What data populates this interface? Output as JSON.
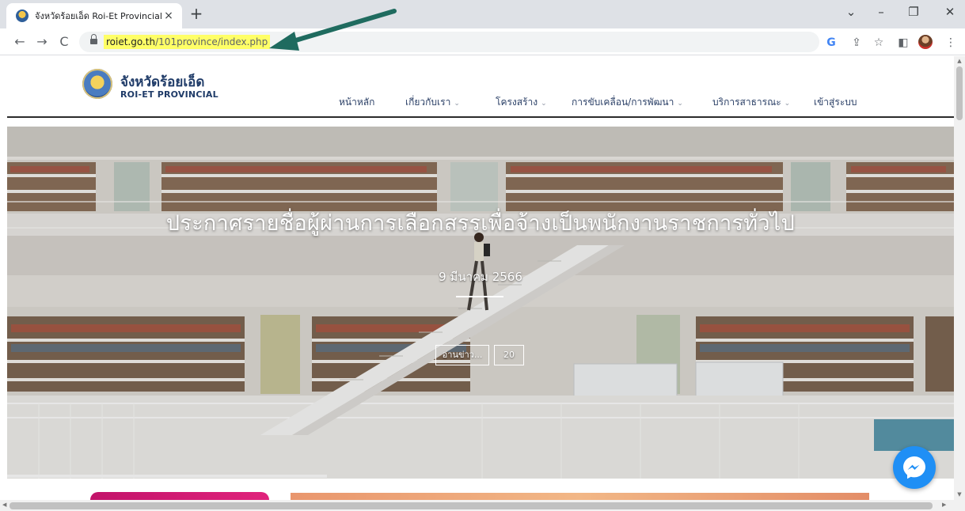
{
  "browser": {
    "tab_title": "จังหวัดร้อยเอ็ด Roi-Et Provincial",
    "tab_close": "×",
    "new_tab": "+",
    "url_domain": "roiet.go.th",
    "url_path": "/101province/index.php",
    "nav": {
      "back": "←",
      "forward": "→",
      "reload": "C"
    },
    "window": {
      "dropdown": "⌄",
      "minimize": "–",
      "restore": "❐",
      "close": "✕"
    },
    "toolbar_icons": {
      "google": "G",
      "share": "⇪",
      "bookmark": "☆",
      "sidepanel": "◧",
      "menu": "⋮"
    }
  },
  "site": {
    "name_th": "จังหวัดร้อยเอ็ด",
    "name_en": "ROI-ET PROVINCIAL",
    "nav": [
      {
        "label": "หน้าหลัก",
        "dropdown": false
      },
      {
        "label": "เกี่ยวกับเรา",
        "dropdown": true
      },
      {
        "label": "โครงสร้าง",
        "dropdown": true
      },
      {
        "label": "การขับเคลื่อน/การพัฒนา",
        "dropdown": true
      },
      {
        "label": "บริการสาธารณะ",
        "dropdown": true
      },
      {
        "label": "เข้าสู่ระบบ",
        "dropdown": false
      }
    ],
    "chevron": "⌄"
  },
  "hero": {
    "title": "ประกาศรายชื่อผู้ผ่านการเลือกสรรเพื่อจ้างเป็นพนักงานราชการทั่วไป",
    "date": "9 มีนาคม 2566",
    "read_more": "อ่านข่าว...",
    "count": "20"
  },
  "colors": {
    "header_text": "#1f3b68",
    "url_highlight": "#ffff66",
    "arrow": "#1f6b5f",
    "messenger": "#1f8ff5"
  }
}
